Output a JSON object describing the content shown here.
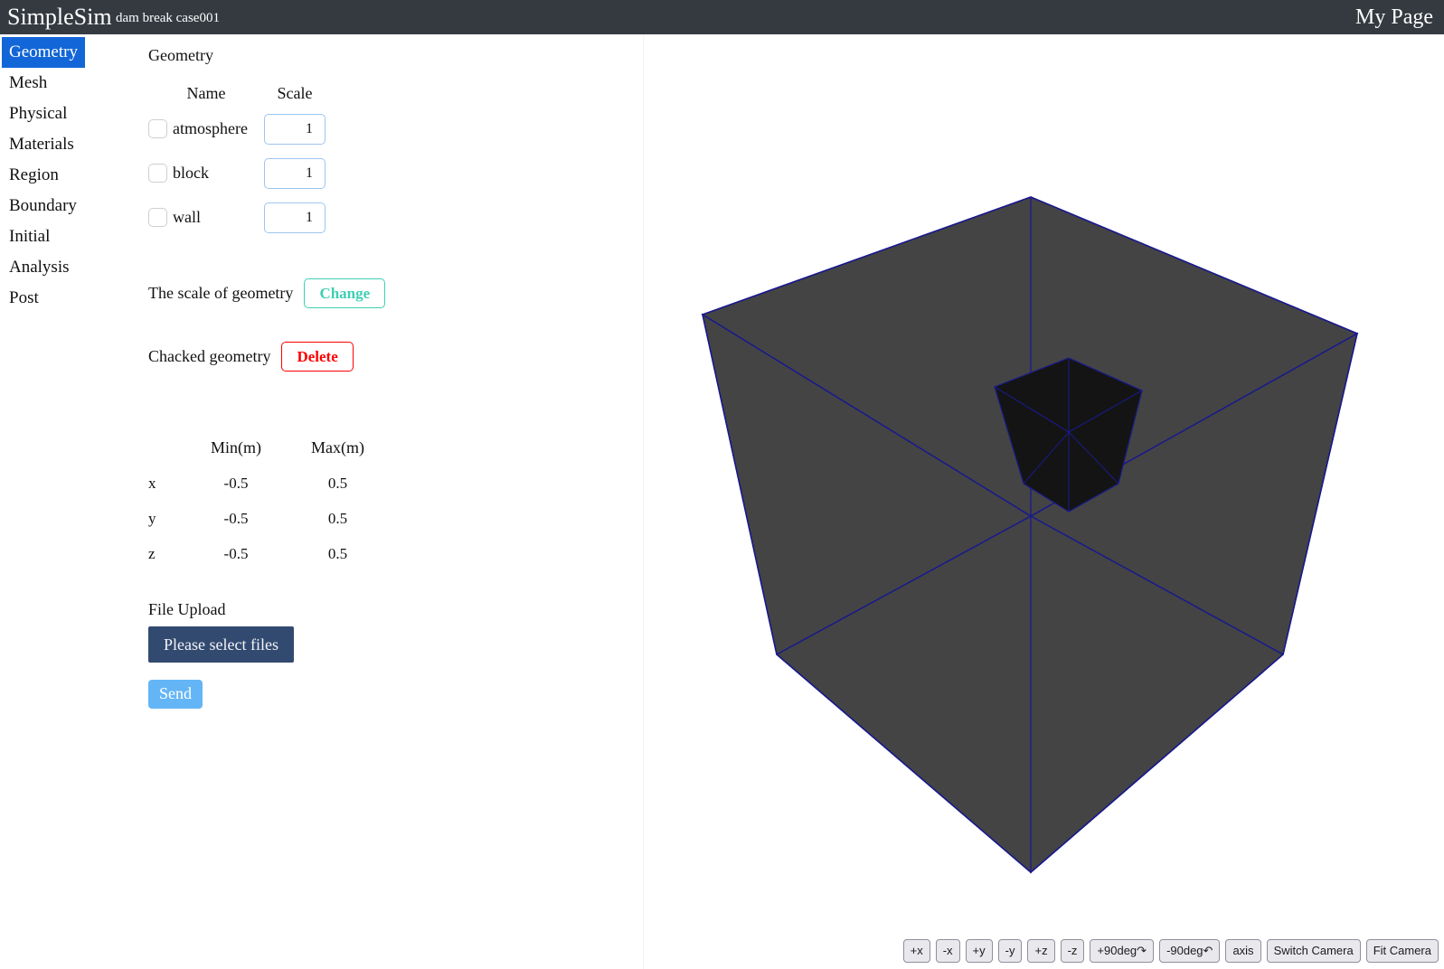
{
  "topbar": {
    "brand": "SimpleSim",
    "case_title": "dam break case001",
    "my_page": "My Page",
    "background": "#343a40"
  },
  "sidebar": {
    "active_color": "#1266d8",
    "items": [
      {
        "label": "Geometry",
        "active": true
      },
      {
        "label": "Mesh",
        "active": false
      },
      {
        "label": "Physical",
        "active": false
      },
      {
        "label": "Materials",
        "active": false
      },
      {
        "label": "Region",
        "active": false
      },
      {
        "label": "Boundary",
        "active": false
      },
      {
        "label": "Initial",
        "active": false
      },
      {
        "label": "Analysis",
        "active": false
      },
      {
        "label": "Post",
        "active": false
      }
    ]
  },
  "geometry_panel": {
    "heading": "Geometry",
    "columns": {
      "name": "Name",
      "scale": "Scale"
    },
    "rows": [
      {
        "name": "atmosphere",
        "scale": "1",
        "checked": false
      },
      {
        "name": "block",
        "scale": "1",
        "checked": false
      },
      {
        "name": "wall",
        "scale": "1",
        "checked": false
      }
    ],
    "scale_action": {
      "label": "The scale of geometry",
      "button": "Change",
      "button_color": "#3ecfb2"
    },
    "delete_action": {
      "label": "Chacked geometry",
      "button": "Delete",
      "button_color": "#ff0000"
    },
    "bounds": {
      "headers": {
        "axis": "",
        "min": "Min(m)",
        "max": "Max(m)"
      },
      "rows": [
        {
          "axis": "x",
          "min": "-0.5",
          "max": "0.5"
        },
        {
          "axis": "y",
          "min": "-0.5",
          "max": "0.5"
        },
        {
          "axis": "z",
          "min": "-0.5",
          "max": "0.5"
        }
      ]
    },
    "upload": {
      "label": "File Upload",
      "select_button": "Please select files",
      "select_button_color": "#334a70",
      "send_button": "Send",
      "send_button_color": "#64b5f6"
    }
  },
  "viewport": {
    "background": "#ffffff",
    "outer_box_fill": "#444444",
    "edge_color": "#1a1a8c",
    "inner_box_fill": "#141414",
    "camera_toolbar": [
      {
        "label": "+x",
        "name": "plus-x"
      },
      {
        "label": "-x",
        "name": "minus-x"
      },
      {
        "label": "+y",
        "name": "plus-y"
      },
      {
        "label": "-y",
        "name": "minus-y"
      },
      {
        "label": "+z",
        "name": "plus-z"
      },
      {
        "label": "-z",
        "name": "minus-z"
      },
      {
        "label": "+90deg↷",
        "name": "rotate-plus-90"
      },
      {
        "label": "-90deg↶",
        "name": "rotate-minus-90"
      },
      {
        "label": "axis",
        "name": "axis"
      },
      {
        "label": "Switch Camera",
        "name": "switch-camera"
      },
      {
        "label": "Fit Camera",
        "name": "fit-camera"
      }
    ]
  }
}
